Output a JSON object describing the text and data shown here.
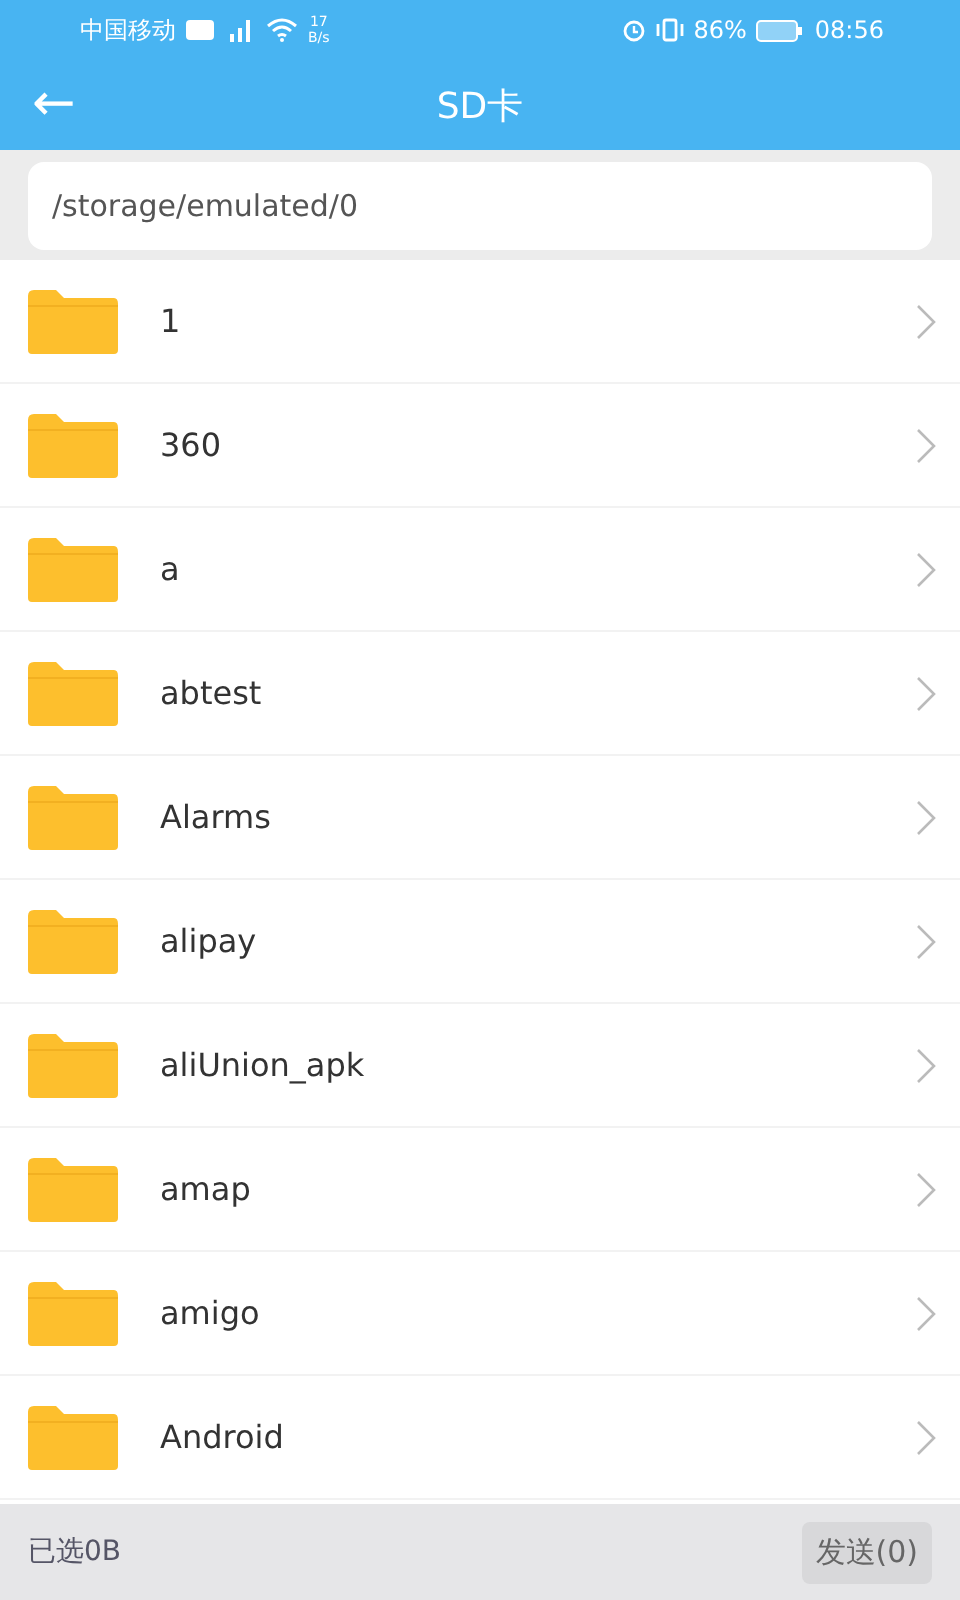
{
  "status_bar": {
    "carrier": "中国移动",
    "speed": "17",
    "speed_unit": "B/s",
    "battery": "86%",
    "time": "08:56"
  },
  "app_bar": {
    "back": "←",
    "title": "SD卡"
  },
  "path": "/storage/emulated/0",
  "folders": [
    {
      "name": "1"
    },
    {
      "name": "360"
    },
    {
      "name": "a"
    },
    {
      "name": "abtest"
    },
    {
      "name": "Alarms"
    },
    {
      "name": "alipay"
    },
    {
      "name": "aliUnion_apk"
    },
    {
      "name": "amap"
    },
    {
      "name": "amigo"
    },
    {
      "name": "Android"
    }
  ],
  "footer": {
    "selected": "已选0B",
    "send": "发送(0)"
  }
}
